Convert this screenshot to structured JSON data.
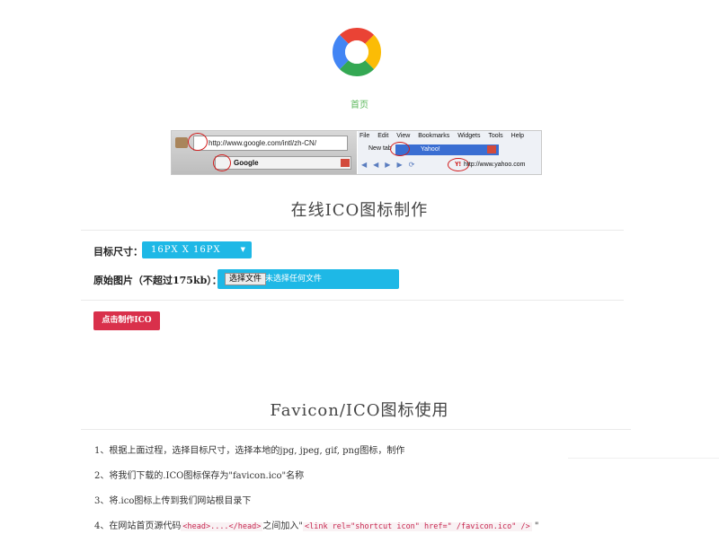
{
  "brand": {
    "logo_colors": [
      "#ea4335",
      "#fbbc05",
      "#34a853",
      "#4285f4"
    ]
  },
  "nav": {
    "home_label": "首页"
  },
  "demo": {
    "google_url": "http://www.google.com/intl/zh-CN/",
    "google_tab": "Google",
    "menu": [
      "File",
      "Edit",
      "View",
      "Bookmarks",
      "Widgets",
      "Tools",
      "Help"
    ],
    "new_tab": "New tab",
    "yahoo_tab": "Yahoo!",
    "yahoo_url": "http://www.yahoo.com"
  },
  "maker": {
    "title": "在线ICO图标制作",
    "size_label": "目标尺寸：",
    "size_value": "16PX  X  16PX",
    "source_label": "原始图片（不超过175kb）：",
    "file_button": "选择文件",
    "file_status": "未选择任何文件",
    "submit_label": "点击制作ICO"
  },
  "usage": {
    "title": "Favicon/ICO图标使用",
    "step1": "1、根据上面过程，选择目标尺寸，选择本地的jpg, jpeg, gif, png图标，制作",
    "step2": "2、将我们下载的.ICO图标保存为\"favicon.ico\"名称",
    "step3": "3、将.ico图标上传到我们网站根目录下",
    "step4_prefix": "4、在网站首页源代码",
    "step4_code1": "<head>....</head>",
    "step4_mid": "之间加入\"",
    "step4_code2": "<link rel=\"shortcut icon\" href=\" /favicon.ico\" />",
    "step4_suffix": " \""
  },
  "colors": {
    "accent_blue": "#1eb8e6",
    "button_red": "#d9304b",
    "home_green": "#5cb85c"
  }
}
